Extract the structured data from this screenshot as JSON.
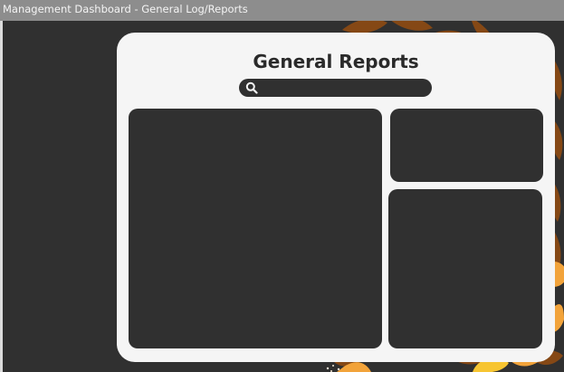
{
  "window": {
    "title": "Management Dashboard - General Log/Reports"
  },
  "report": {
    "title": "General Reports"
  },
  "search": {
    "placeholder": "",
    "value": ""
  },
  "colors": {
    "background": "#303030",
    "card": "#f5f5f5",
    "titlebar": "#8d8d8d",
    "leaf": "#8a4a14",
    "accent_orange": "#f2a33a",
    "accent_yellow": "#f7c531"
  },
  "icons": {
    "search": "search-icon"
  }
}
